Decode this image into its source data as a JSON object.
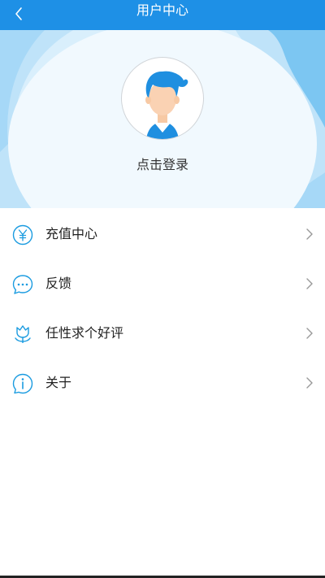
{
  "header": {
    "title": "用户中心",
    "back_icon": "chevron-left-icon"
  },
  "profile": {
    "avatar_icon": "user-avatar-icon",
    "login_label": "点击登录"
  },
  "menu": {
    "items": [
      {
        "label": "充值中心",
        "icon": "yen-icon"
      },
      {
        "label": "反馈",
        "icon": "chat-bubble-icon"
      },
      {
        "label": "任性求个好评",
        "icon": "tulip-icon"
      },
      {
        "label": "关于",
        "icon": "info-icon"
      }
    ]
  },
  "colors": {
    "primary": "#1e90e6",
    "icon": "#1a9be0",
    "hero_light": "#eaf6fd",
    "hero_wave": "#9ed5f7"
  }
}
